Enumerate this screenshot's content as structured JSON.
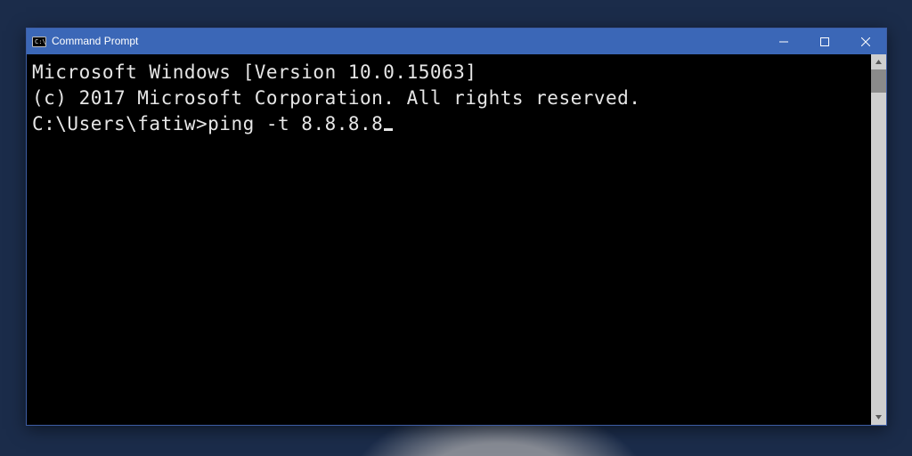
{
  "window": {
    "title": "Command Prompt"
  },
  "console": {
    "line1": "Microsoft Windows [Version 10.0.15063]",
    "line2": "(c) 2017 Microsoft Corporation. All rights reserved.",
    "blank": "",
    "prompt": "C:\\Users\\fatiw>",
    "command": "ping -t 8.8.8.8"
  }
}
